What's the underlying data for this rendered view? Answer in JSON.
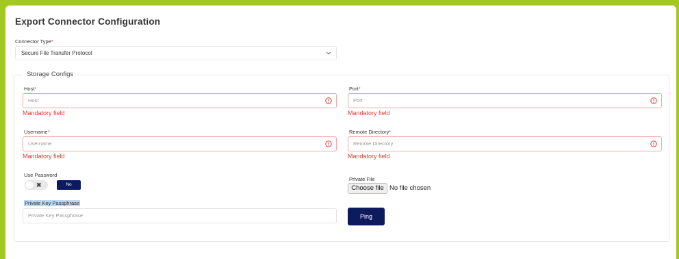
{
  "page": {
    "title": "Export Connector Configuration"
  },
  "connector_type": {
    "label": "Connector Type",
    "required_mark": "*",
    "value": "Secure File Transfer Protocol"
  },
  "storage": {
    "legend": "Storage Configs",
    "host": {
      "label": "Host",
      "required_mark": "*",
      "placeholder": "Host",
      "error": "Mandatory field"
    },
    "port": {
      "label": "Port",
      "required_mark": "*",
      "placeholder": "Port",
      "error": "Mandatory field"
    },
    "username": {
      "label": "Username",
      "required_mark": "*",
      "placeholder": "Username",
      "error": "Mandatory field"
    },
    "remote_directory": {
      "label": "Remote Directory",
      "required_mark": "*",
      "placeholder": "Remote Directory",
      "error": "Mandatory field"
    },
    "use_password": {
      "label": "Use Password",
      "toggle_icon": "✖",
      "state_label": "No"
    },
    "private_file": {
      "label": "Private File",
      "button_label": "Choose file",
      "status": "No file chosen"
    },
    "passphrase": {
      "label": "Private Key Passphrase",
      "placeholder": "Private Key Passphrase"
    },
    "ping_label": "Ping"
  },
  "colors": {
    "background": "#a4c822",
    "error": "#e53935",
    "primary": "#0d1b5e"
  }
}
